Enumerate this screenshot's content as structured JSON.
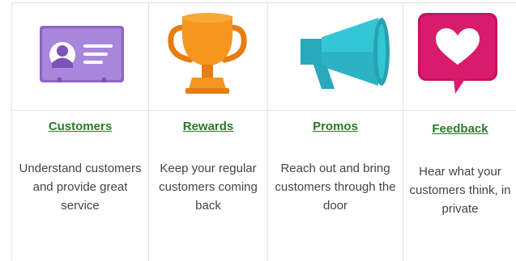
{
  "features": [
    {
      "title": "Customers",
      "description": "Understand customers and provide great service",
      "icon": "id-card-icon",
      "color": "#a37fd6"
    },
    {
      "title": "Rewards",
      "description": "Keep your regular customers coming back",
      "icon": "trophy-icon",
      "color": "#f08a1c"
    },
    {
      "title": "Promos",
      "description": "Reach out and bring customers through the door",
      "icon": "megaphone-icon",
      "color": "#35c6d6"
    },
    {
      "title": "Feedback",
      "description": "Hear what your customers think, in private",
      "icon": "heart-chat-icon",
      "color": "#d4146b"
    }
  ],
  "colors": {
    "link": "#2a7a2a",
    "text": "#444444",
    "border": "#e2e2e2"
  }
}
